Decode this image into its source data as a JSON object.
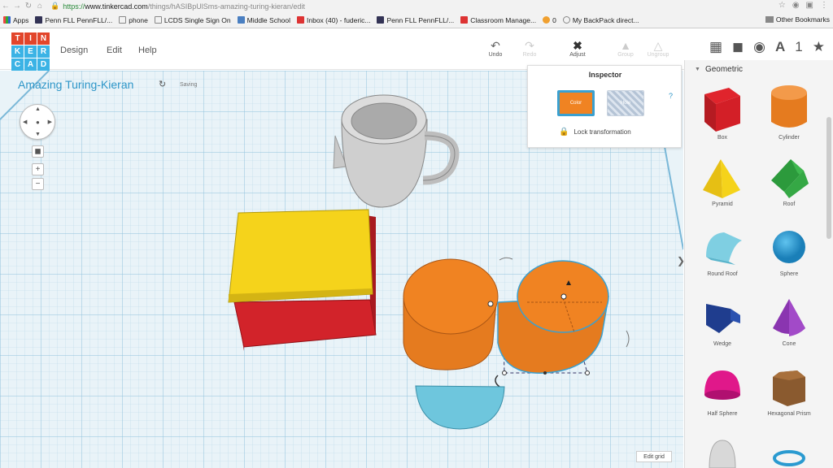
{
  "browser": {
    "url_https": "https://",
    "url_host": "www.tinkercad.com",
    "url_path": "/things/hASIBpUlSms-amazing-turing-kieran/edit",
    "bookmarks": [
      "Apps",
      "Penn FLL PennFLL/...",
      "phone",
      "LCDS Single Sign On",
      "Middle School",
      "Inbox (40) - fuderic...",
      "Penn FLL PennFLL/...",
      "Classroom Manage...",
      "0",
      "My BackPack direct..."
    ],
    "other_bookmarks": "Other Bookmarks"
  },
  "app": {
    "logo_letters": [
      "T",
      "I",
      "N",
      "K",
      "E",
      "R",
      "C",
      "A",
      "D"
    ],
    "menu": [
      "Design",
      "Edit",
      "Help"
    ],
    "tools": {
      "undo": "Undo",
      "redo": "Redo",
      "adjust": "Adjust",
      "group": "Group",
      "ungroup": "Ungroup"
    },
    "project_title": "Amazing Turing-Kieran",
    "status": "Saving",
    "view_number": "1"
  },
  "inspector": {
    "title": "Inspector",
    "help": "?",
    "color_label": "Color",
    "hole_label": "Hole",
    "lock_label": "Lock transformation"
  },
  "workplane": {
    "edit_grid": "Edit grid"
  },
  "shapes_panel": {
    "category": "Geometric",
    "shapes": [
      "Box",
      "Cylinder",
      "Pyramid",
      "Roof",
      "Round Roof",
      "Sphere",
      "Wedge",
      "Cone",
      "Half Sphere",
      "Hexagonal Prism"
    ]
  },
  "colors": {
    "accent": "#2e96c8",
    "selected_color": "#f08322",
    "grid": "#e9f3f8"
  }
}
